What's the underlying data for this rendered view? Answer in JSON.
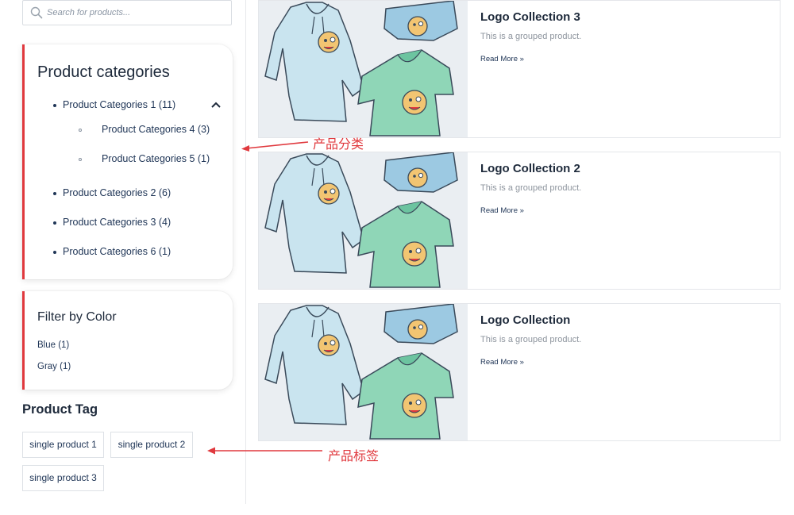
{
  "search": {
    "placeholder": "Search for products..."
  },
  "categories": {
    "title": "Product categories",
    "items": [
      {
        "label": "Product Categories 1 (11)"
      },
      {
        "label": "Product Categories 4 (3)"
      },
      {
        "label": "Product Categories 5 (1)"
      },
      {
        "label": "Product Categories 2 (6)"
      },
      {
        "label": "Product Categories 3 (4)"
      },
      {
        "label": "Product Categories 6 (1)"
      }
    ]
  },
  "color_filter": {
    "title": "Filter by Color",
    "items": [
      {
        "label": "Blue (1)"
      },
      {
        "label": "Gray (1)"
      }
    ]
  },
  "tags": {
    "title": "Product Tag",
    "items": [
      {
        "label": "single product 1"
      },
      {
        "label": "single product 2"
      },
      {
        "label": "single product 3"
      }
    ]
  },
  "products": [
    {
      "title": "Logo Collection 3",
      "description": "This is a grouped product.",
      "link": "Read More »"
    },
    {
      "title": "Logo Collection 2",
      "description": "This is a grouped product.",
      "link": "Read More »"
    },
    {
      "title": "Logo Collection",
      "description": "This is a grouped product.",
      "link": "Read More »"
    }
  ],
  "annotations": {
    "categories_note": "产品分类",
    "tags_note": "产品标签"
  },
  "colors": {
    "accent": "#e0393e",
    "link": "#1f3556",
    "hoodie": "#c9e4ef",
    "tshirt": "#8fd6b7",
    "beanie": "#9cc9e2",
    "emoji": "#f2c572"
  },
  "icons": [
    "search-icon",
    "chevron-up-icon",
    "arrow-left-icon"
  ]
}
